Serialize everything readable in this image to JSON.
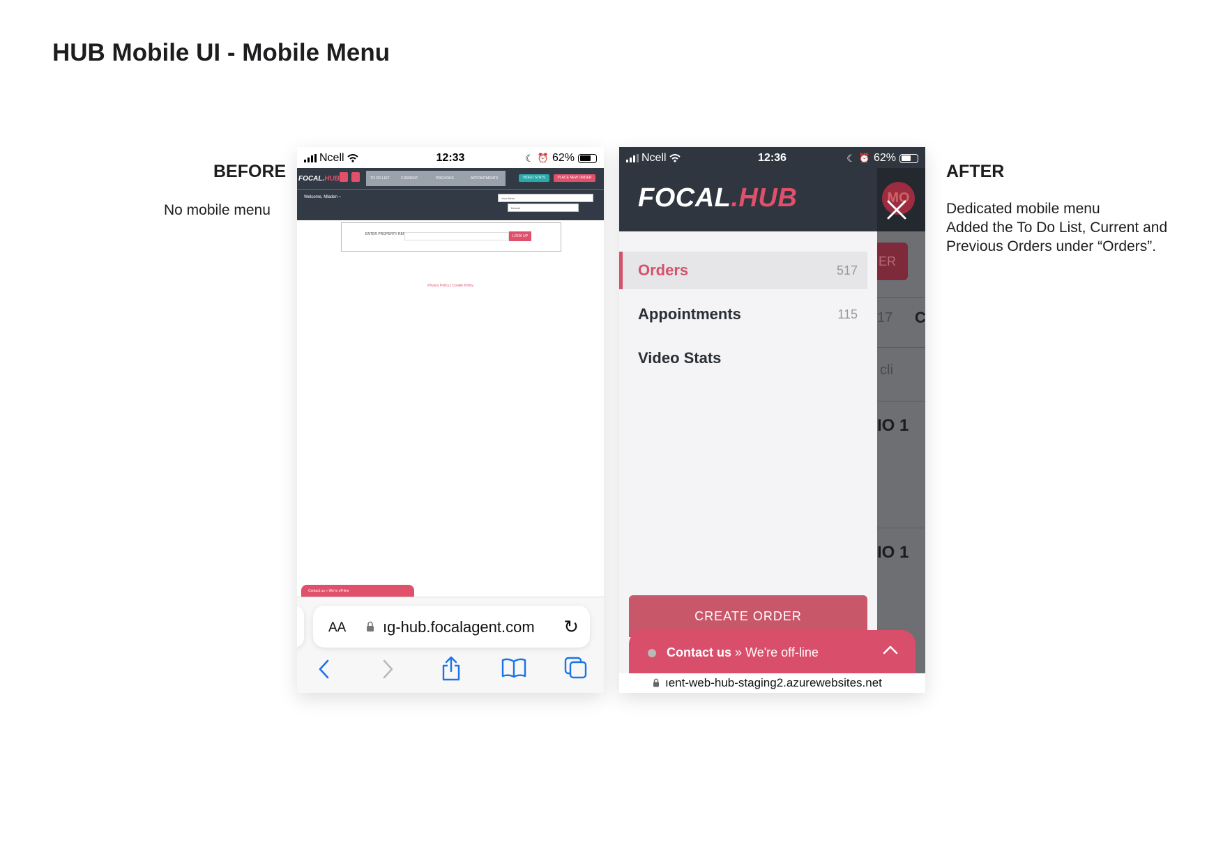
{
  "page": {
    "title": "HUB Mobile UI - Mobile Menu"
  },
  "before": {
    "heading": "BEFORE",
    "caption": "No mobile menu",
    "status_bar": {
      "carrier": "Ncell",
      "time": "12:33",
      "battery": "62%"
    },
    "nav": {
      "logo_main": "FOCAL.",
      "logo_accent": "HUB",
      "tabs": [
        "TO DO LIST",
        "CURRENT",
        "PREVIOUS",
        "APPOINTMENTS"
      ],
      "video_stats_label": "VIDEO STATS",
      "place_order_label": "PLACE NEW ORDER"
    },
    "welcome": "Welcome, Mladen ~",
    "select_1": "Your Menu",
    "select_2": "Default",
    "form": {
      "label": "ENTER PROPERTY REF",
      "button": "LOOK UP"
    },
    "policy_links": "Privacy Policy | Cookie Policy",
    "chat_label": "Contact us » We're off-line",
    "safari": {
      "aa_label": "AA",
      "url": "ıg-hub.focalagent.com"
    }
  },
  "after": {
    "heading": "AFTER",
    "caption_lines": [
      "Dedicated mobile menu",
      "Added the To Do List, Current and",
      "Previous Orders under “Orders”."
    ],
    "status_bar": {
      "carrier": "Ncell",
      "time": "12:36",
      "battery": "62%"
    },
    "logo_main": "FOCAL",
    "logo_accent": ".HUB",
    "avatar_initials": "MO",
    "menu": [
      {
        "label": "Orders",
        "count": "517",
        "active": true
      },
      {
        "label": "Appointments",
        "count": "115",
        "active": false
      },
      {
        "label": "Video Stats",
        "count": "",
        "active": false
      }
    ],
    "background_fragments": [
      "ER",
      "17",
      "C",
      "cli",
      "IO 1",
      "IO 1"
    ],
    "create_order_label": "CREATE ORDER",
    "contact": {
      "bold": "Contact us",
      "sep": " » ",
      "status": "We're off-line"
    },
    "url": "ıent-web-hub-staging2.azurewebsites.net"
  },
  "colors": {
    "brand_pink": "#e0506a",
    "nav_dark": "#2f363f",
    "drawer_bg": "#f4f4f6"
  }
}
